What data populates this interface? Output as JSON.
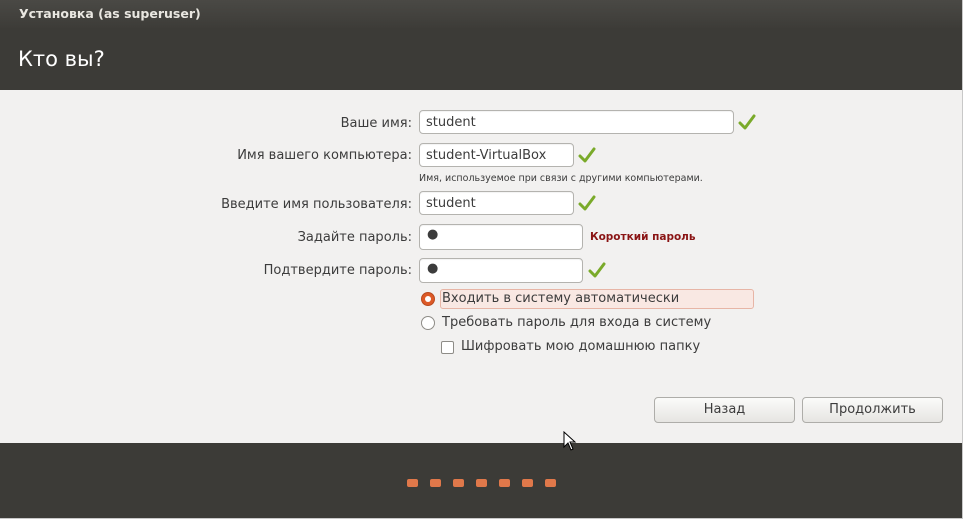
{
  "window": {
    "title": "Установка (as superuser)"
  },
  "page": {
    "title": "Кто вы?"
  },
  "form": {
    "name": {
      "label": "Ваше имя:",
      "value": "student",
      "valid": true
    },
    "computer": {
      "label": "Имя вашего компьютера:",
      "value": "student-VirtualBox",
      "valid": true,
      "hint": "Имя, используемое при связи с другими компьютерами."
    },
    "username": {
      "label": "Введите имя пользователя:",
      "value": "student",
      "valid": true
    },
    "password": {
      "label": "Задайте пароль:",
      "value": "●",
      "strength": "Короткий пароль"
    },
    "confirm": {
      "label": "Подтвердите пароль:",
      "value": "●",
      "valid": true
    }
  },
  "login_options": {
    "auto_login": {
      "label": "Входить в систему автоматически",
      "selected": true
    },
    "require_password": {
      "label": "Требовать пароль для входа в систему",
      "selected": false
    },
    "encrypt_home": {
      "label": "Шифровать мою домашнюю папку",
      "checked": false
    }
  },
  "buttons": {
    "back": "Назад",
    "continue": "Продолжить"
  },
  "progress": {
    "total_steps": 7,
    "current_step": 7
  },
  "colors": {
    "header_bg": "#3c3b37",
    "content_bg": "#f2f1f0",
    "accent": "#dd5a27",
    "check_green": "#7aaa2a",
    "warning_red": "#8a1414",
    "progress_dot": "#e0784a"
  },
  "icons": {
    "valid": "check-icon",
    "pointer": "mouse-cursor-icon"
  }
}
